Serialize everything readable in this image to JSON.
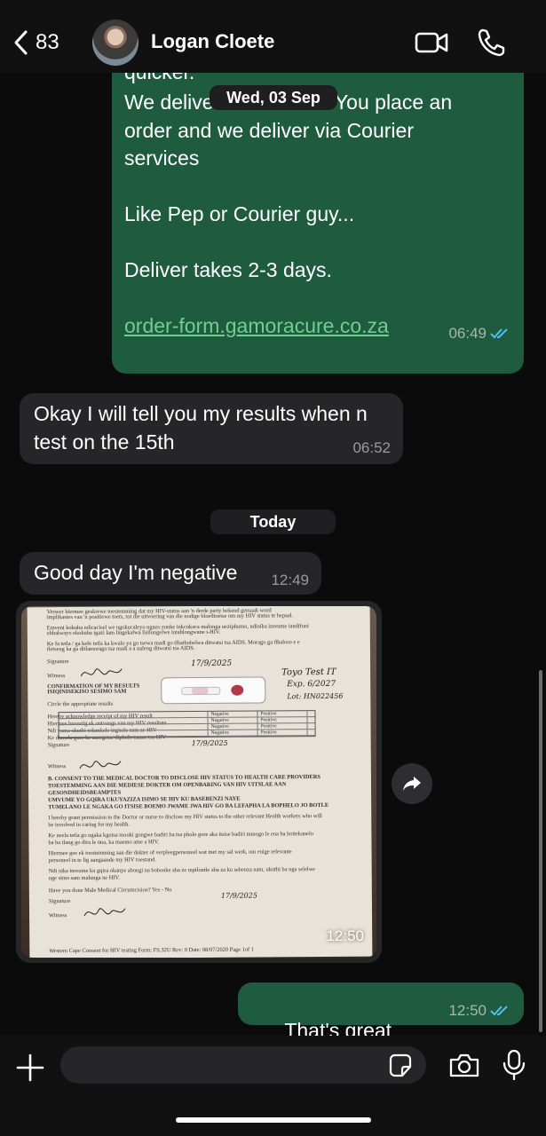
{
  "header": {
    "back_count": "83",
    "contact_name": "Logan Cloete"
  },
  "messages": {
    "out1": {
      "partial_top": "quicker.",
      "text": "We deliver nationwide. You place an\norder and we deliver via Courier\nservices\n\nLike Pep or Courier guy...\n\nDeliver takes 2-3 days.",
      "link": "order-form.gamoracure.co.za",
      "time": "06:49"
    },
    "date1": "Wed, 03 Sep",
    "in1": {
      "text": "Okay I will tell you my results when n\ntest on the 15th",
      "time": "06:52"
    },
    "date2": "Today",
    "in2": {
      "text": "Good day I'm negative",
      "time": "12:49"
    },
    "photo": {
      "time": "12:50",
      "doc_lines": [
        "Verseer hiermee geskrewe toestemming dat my HIV-status aan 'n derde party bekend gemaak word",
        "implikasies van 'n positiewe toets, tot die uitvoering van die nodige bloedtoetse om my HIV status te bepaal.",
        "Emveni kokuba ndicacisel we ngokucaleyo ngazo zonke inkcukaca malunga neziphumo, ndinika imvume iandifuni",
        "ebhalwayo ekokuba igazi lam lingekalwa lisilongelwe intahlongwane i-HIV.",
        "Ke fa tetla / ga kefe tetla ka kwalo ya go tsewa madi go tlhathobelwa ditwatsi tsa AIDS. Morago ga tlhaloso e e",
        "tletseng ka ga ditlamorago tsa madi a a naleng ditwatsi tsa AIDS.",
        "Signature",
        "Witness",
        "CONFIRMATION OF MY RESULTS",
        "ISIQINISEKISO SESIMO SAM",
        "Circle the appropriate results",
        "Hereby acknowledge receipt of my HIV result",
        "Hiermee bevestig ek ontvangs van my HIV resultate",
        "Ndi vuma ukuthi ndamkele ingxelo zam ze HIV",
        "Ke dumela gore ke amogetse dipholo tsame tsa HIV",
        "Signature",
        "Witness",
        "B.   CONSENT TO THE MEDICAL DOCTOR TO DISCLOSE HIV STATUS TO HEALTH CARE PROVIDERS",
        "TOESTEMMING AAN DIE MEDIESE DOKTER OM OPENBARING VAN HIV UITSLAE AAN",
        "GESONDHEIDSBEAMPTES",
        "UMVUME YO GQIRA UKUYAZIZA ISIMO SE HIV KU BASEBENZI NAYE",
        "TUMELANO LE NGAKA GO ITSISE BOEMO JWAME JWA HIV GO BA LEFAPHA LA BOPHELO JO BOTLE",
        "I hereby grant permission to the Doctor or nurse to disclose my HIV status to the other relevant Health workers who will",
        "be involved in caring for my health.",
        "Ke neela tetla go ngaka kgotsa mooki gongwe badiri ba tsa pholo gore aka itsise badiri mmogo le ena ba boitekanelo",
        "ba ba tlang go dira le nna, ka maemo ame a HIV.",
        "Hiermee gee ek toestemming aan die dokter of verpleegpersoneel wat met my sal werk, om enige relevante",
        "personeel in te lig aangaande my HIV toestand.",
        "Ndi nika imvume ku gqira okanye abongi na bobonke aba ze mpilontle aba za ku sebenza nam, ukuthi ba nga selelwe",
        "nge simo sam malunga ne HIV.",
        "Have you done Male Medical Circumcision? Yes - No",
        "Signature",
        "Witness",
        "Western Cape Consent for HIV testing    Form: FS.32U    Rev: 0    Date: 08/07/2020    Page 1of 1"
      ],
      "handwritten": {
        "date": "17/9/2025",
        "test_name": "Toyo Test IT",
        "exp": "Exp. 6/2027",
        "lot": "Lot: HN022456"
      },
      "results_table": [
        [
          "Negative",
          "Positive"
        ],
        [
          "Negative",
          "Positive"
        ],
        [
          "Negative",
          "Positive"
        ],
        [
          "Negative",
          "Positive"
        ]
      ]
    },
    "out2": {
      "text": "That's great",
      "emoji": "🙏🏽💯",
      "time": "12:50"
    }
  },
  "input": {
    "placeholder": ""
  },
  "colors": {
    "outgoing_bubble": "#1f5c3f",
    "incoming_bubble": "#262628",
    "read_ticks": "#53bdeb",
    "link": "#6fcf8e"
  },
  "icons": [
    "chevron-left-icon",
    "video-call-icon",
    "phone-icon",
    "forward-icon",
    "plus-icon",
    "sticker-icon",
    "camera-icon",
    "microphone-icon",
    "double-check-icon"
  ]
}
